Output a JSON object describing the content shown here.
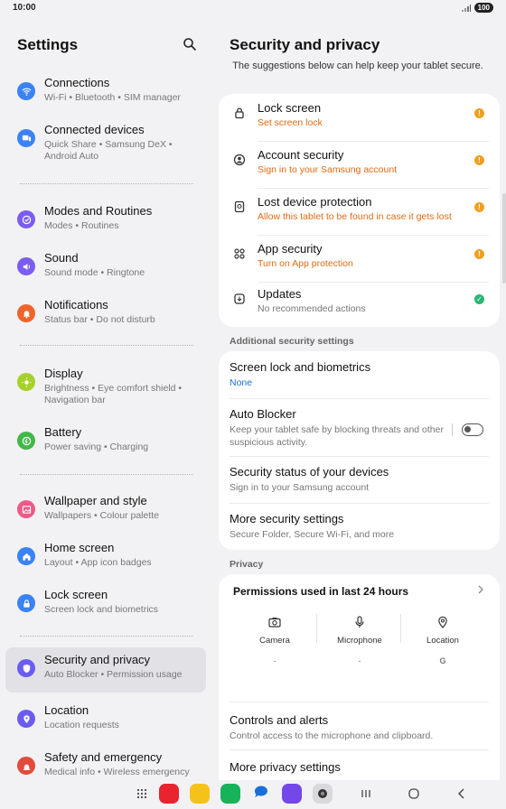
{
  "status": {
    "time": "10:00",
    "battery": "100"
  },
  "left": {
    "title": "Settings",
    "items": [
      {
        "title": "Connections",
        "sub": "Wi-Fi  •  Bluetooth  •  SIM manager",
        "color": "#3b82f6",
        "icon": "wifi-icon"
      },
      {
        "title": "Connected devices",
        "sub": "Quick Share  •  Samsung DeX  •  Android Auto",
        "color": "#3b82f6",
        "icon": "devices-icon"
      },
      {
        "title": "Modes and Routines",
        "sub": "Modes  •  Routines",
        "color": "#7c5cf0",
        "icon": "modes-icon"
      },
      {
        "title": "Sound",
        "sub": "Sound mode  •  Ringtone",
        "color": "#7c5cf0",
        "icon": "sound-icon"
      },
      {
        "title": "Notifications",
        "sub": "Status bar  •  Do not disturb",
        "color": "#f0642b",
        "icon": "bell-icon"
      },
      {
        "title": "Display",
        "sub": "Brightness  •  Eye comfort shield  •  Navigation bar",
        "color": "#a6d12c",
        "icon": "sun-icon"
      },
      {
        "title": "Battery",
        "sub": "Power saving  •  Charging",
        "color": "#44b74a",
        "icon": "battery-icon"
      },
      {
        "title": "Wallpaper and style",
        "sub": "Wallpapers  •  Colour palette",
        "color": "#ee5a87",
        "icon": "wallpaper-icon"
      },
      {
        "title": "Home screen",
        "sub": "Layout  •  App icon badges",
        "color": "#3b82f6",
        "icon": "home-icon"
      },
      {
        "title": "Lock screen",
        "sub": "Screen lock and biometrics",
        "color": "#3b82f6",
        "icon": "lock-icon"
      },
      {
        "title": "Security and privacy",
        "sub": "Auto Blocker  •  Permission usage",
        "color": "#6b5cf0",
        "icon": "shield-icon"
      },
      {
        "title": "Location",
        "sub": "Location requests",
        "color": "#6b5cf0",
        "icon": "location-icon"
      },
      {
        "title": "Safety and emergency",
        "sub": "Medical info  •  Wireless emergency",
        "color": "#e24b3c",
        "icon": "emergency-icon"
      }
    ]
  },
  "right": {
    "title": "Security and privacy",
    "subtitle": "The suggestions below can help keep your tablet secure.",
    "suggestions": [
      {
        "title": "Lock screen",
        "sub": "Set screen lock",
        "status": "warning",
        "icon": "lock-icon"
      },
      {
        "title": "Account security",
        "sub": "Sign in to your Samsung account",
        "status": "warning",
        "icon": "account-icon"
      },
      {
        "title": "Lost device protection",
        "sub": "Allow this tablet to be found in case it gets lost",
        "status": "warning",
        "icon": "lost-device-icon"
      },
      {
        "title": "App security",
        "sub": "Turn on App protection",
        "status": "warning",
        "icon": "apps-icon"
      },
      {
        "title": "Updates",
        "sub": "No recommended actions",
        "status": "ok",
        "icon": "update-icon"
      }
    ],
    "additional_header": "Additional security settings",
    "additional": [
      {
        "title": "Screen lock and biometrics",
        "sub": "None"
      },
      {
        "title": "Auto Blocker",
        "sub": "Keep your tablet safe by blocking threats and other suspicious activity."
      },
      {
        "title": "Security status of your devices",
        "sub": "Sign in to your Samsung account"
      },
      {
        "title": "More security settings",
        "sub": "Secure Folder, Secure Wi-Fi, and more"
      }
    ],
    "privacy_header": "Privacy",
    "permissions": {
      "title": "Permissions used in last 24 hours",
      "items": [
        {
          "label": "Camera",
          "value": "-"
        },
        {
          "label": "Microphone",
          "value": "-"
        },
        {
          "label": "Location",
          "value": "G"
        }
      ]
    },
    "privacy_rows": [
      {
        "title": "Controls and alerts",
        "sub": "Control access to the microphone and clipboard."
      },
      {
        "title": "More privacy settings",
        "sub": ""
      }
    ]
  },
  "colors": {
    "warning": "#f0a020",
    "ok": "#2bb673",
    "warning_text": "#e26b12",
    "link": "#1a6fd6"
  }
}
